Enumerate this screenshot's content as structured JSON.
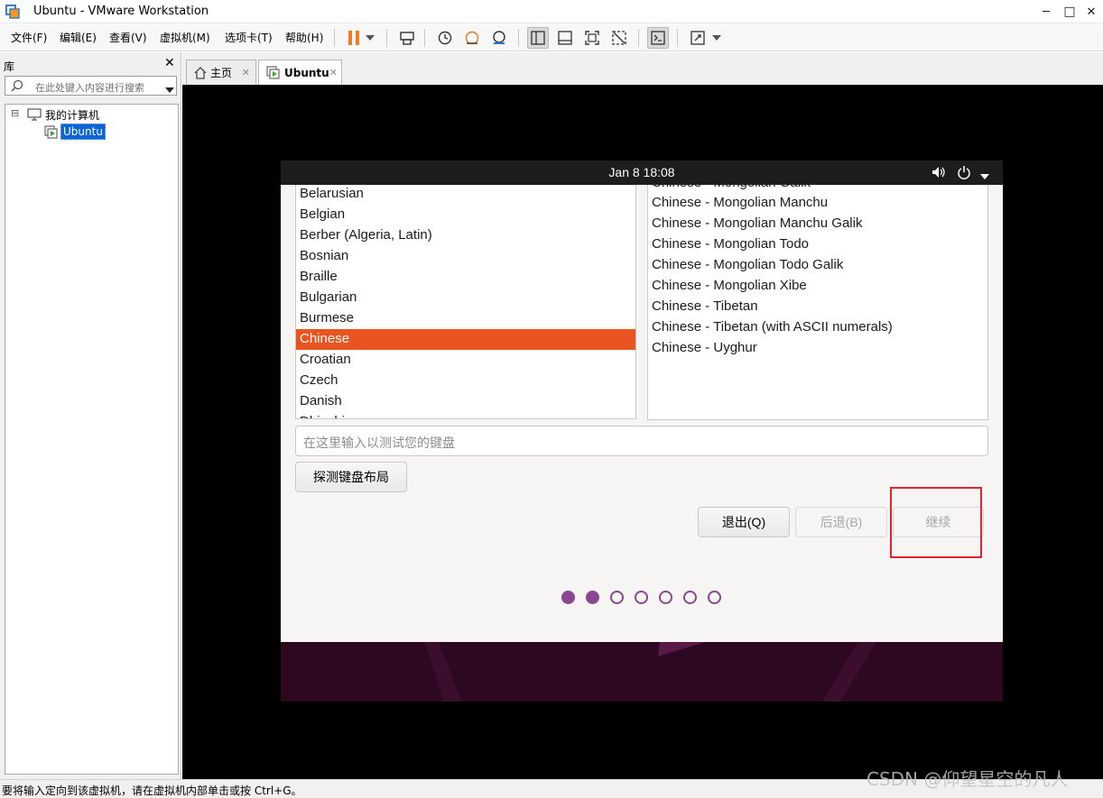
{
  "window": {
    "title": "Ubuntu - VMware Workstation",
    "minimize": "─",
    "maximize": "□",
    "close": "✕"
  },
  "menu": {
    "items": [
      "文件(F)",
      "编辑(E)",
      "查看(V)",
      "虚拟机(M)",
      "选项卡(T)",
      "帮助(H)"
    ]
  },
  "library": {
    "title": "库",
    "close": "✕",
    "search_placeholder": "在此处键入内容进行搜索",
    "tree_root": "我的计算机",
    "tree_child": "Ubuntu",
    "expander": "⊟"
  },
  "tabs": [
    {
      "label": "主页",
      "close": "✕"
    },
    {
      "label": "Ubuntu",
      "close": "✕"
    }
  ],
  "ubuntu": {
    "clock": "Jan 8  18:08",
    "layouts": [
      "Belarusian",
      "Belgian",
      "Berber (Algeria, Latin)",
      "Bosnian",
      "Braille",
      "Bulgarian",
      "Burmese",
      "Chinese",
      "Croatian",
      "Czech",
      "Danish",
      "Dhivehi"
    ],
    "selected_layout": "Chinese",
    "variants": [
      "Chinese - Mongolian Galik",
      "Chinese - Mongolian Manchu",
      "Chinese - Mongolian Manchu Galik",
      "Chinese - Mongolian Todo",
      "Chinese - Mongolian Todo Galik",
      "Chinese - Mongolian Xibe",
      "Chinese - Tibetan",
      "Chinese - Tibetan (with ASCII numerals)",
      "Chinese - Uyghur"
    ],
    "test_placeholder": "在这里输入以测试您的键盘",
    "detect_button": "探测键盘布局",
    "quit_button": "退出(Q)",
    "back_button": "后退(B)",
    "continue_button": "继续",
    "progress": {
      "total_steps": 7,
      "current_step": 2
    }
  },
  "status": {
    "text": "要将输入定向到该虚拟机，请在虚拟机内部单击或按 Ctrl+G。"
  },
  "watermark": "CSDN @仰望星空的凡人",
  "colors": {
    "ubuntu_orange": "#e95420",
    "ubuntu_purple": "#8c4691",
    "highlight_red": "#e0262c"
  }
}
